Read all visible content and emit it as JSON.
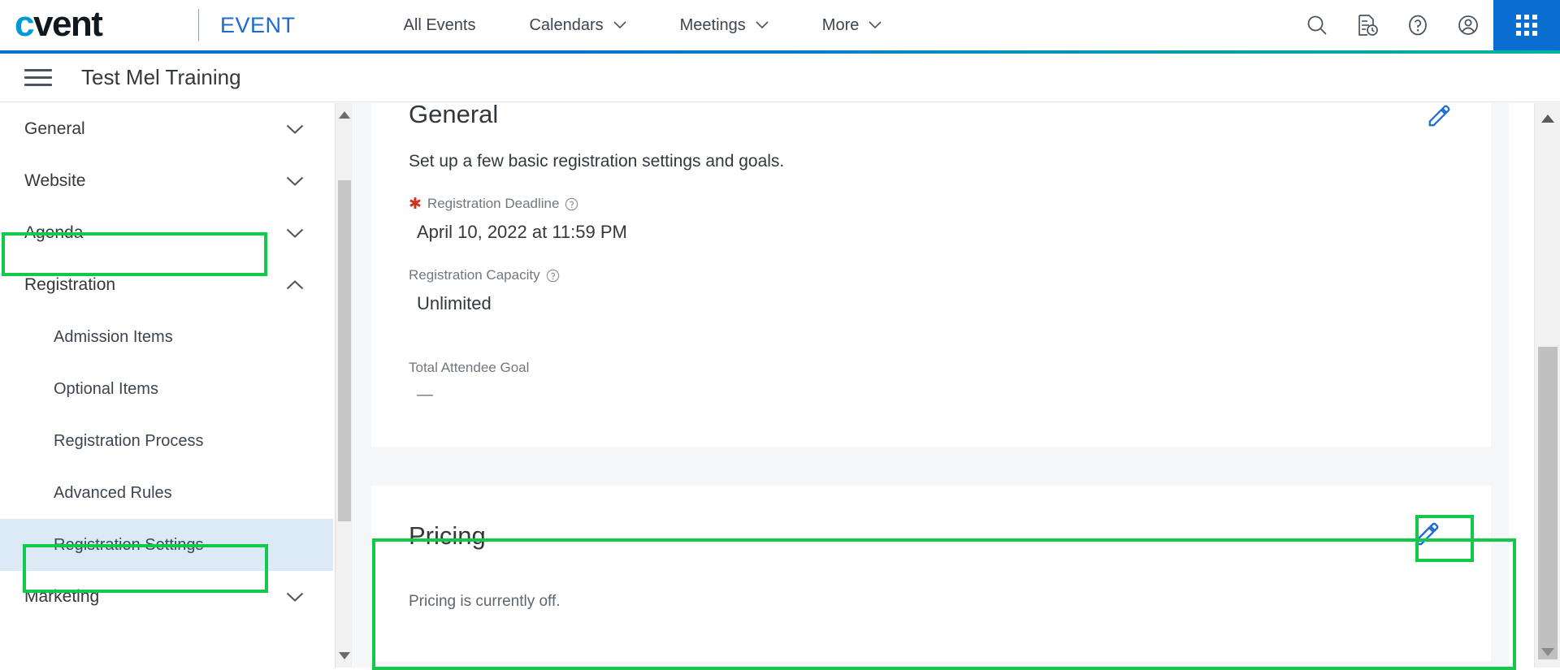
{
  "topbar": {
    "logo_text": "cvent",
    "product_label": "EVENT",
    "nav": [
      {
        "label": "All Events",
        "has_caret": false
      },
      {
        "label": "Calendars",
        "has_caret": true
      },
      {
        "label": "Meetings",
        "has_caret": true
      },
      {
        "label": "More",
        "has_caret": true
      }
    ],
    "icons": [
      {
        "name": "search-icon"
      },
      {
        "name": "recent-document-icon"
      },
      {
        "name": "help-icon"
      },
      {
        "name": "account-icon"
      },
      {
        "name": "app-launcher-icon"
      }
    ],
    "accent_blue": "#0a6ed1",
    "accent_teal": "#00b4a0"
  },
  "eventbar": {
    "menu_icon": "hamburger-menu-icon",
    "title": "Test Mel Training"
  },
  "sidebar": {
    "items": [
      {
        "label": "General",
        "type": "group",
        "expanded": false,
        "selected": false,
        "highlighted": false
      },
      {
        "label": "Website",
        "type": "group",
        "expanded": false,
        "selected": false,
        "highlighted": false
      },
      {
        "label": "Agenda",
        "type": "group",
        "expanded": false,
        "selected": false,
        "highlighted": false
      },
      {
        "label": "Registration",
        "type": "group",
        "expanded": true,
        "selected": false,
        "highlighted": true
      },
      {
        "label": "Admission Items",
        "type": "sub",
        "expanded": false,
        "selected": false,
        "highlighted": false
      },
      {
        "label": "Optional Items",
        "type": "sub",
        "expanded": false,
        "selected": false,
        "highlighted": false
      },
      {
        "label": "Registration Process",
        "type": "sub",
        "expanded": false,
        "selected": false,
        "highlighted": false
      },
      {
        "label": "Advanced Rules",
        "type": "sub",
        "expanded": false,
        "selected": false,
        "highlighted": false
      },
      {
        "label": "Registration Settings",
        "type": "sub",
        "expanded": false,
        "selected": true,
        "highlighted": true
      },
      {
        "label": "Marketing",
        "type": "group",
        "expanded": false,
        "selected": false,
        "highlighted": false
      }
    ],
    "selected_bg": "#dce9f7",
    "highlight_color": "#13c94a"
  },
  "main": {
    "general": {
      "title": "General",
      "subtitle": "Set up a few basic registration settings and goals.",
      "edit_icon": "pencil-edit-icon",
      "fields": [
        {
          "label": "Registration Deadline",
          "required": true,
          "help": true,
          "value": "April 10, 2022 at 11:59 PM"
        },
        {
          "label": "Registration Capacity",
          "required": false,
          "help": true,
          "value": "Unlimited"
        },
        {
          "label": "Total Attendee Goal",
          "required": false,
          "help": false,
          "value": "—"
        }
      ]
    },
    "pricing": {
      "title": "Pricing",
      "note": "Pricing is currently off.",
      "edit_icon": "pencil-edit-icon",
      "highlighted": true
    }
  },
  "scrollbars": {
    "sidebar": {
      "up_arrow": "scroll-up-arrow",
      "down_arrow": "scroll-down-arrow"
    },
    "content": {
      "up_arrow": "scroll-up-arrow",
      "down_arrow": "scroll-down-arrow"
    }
  }
}
